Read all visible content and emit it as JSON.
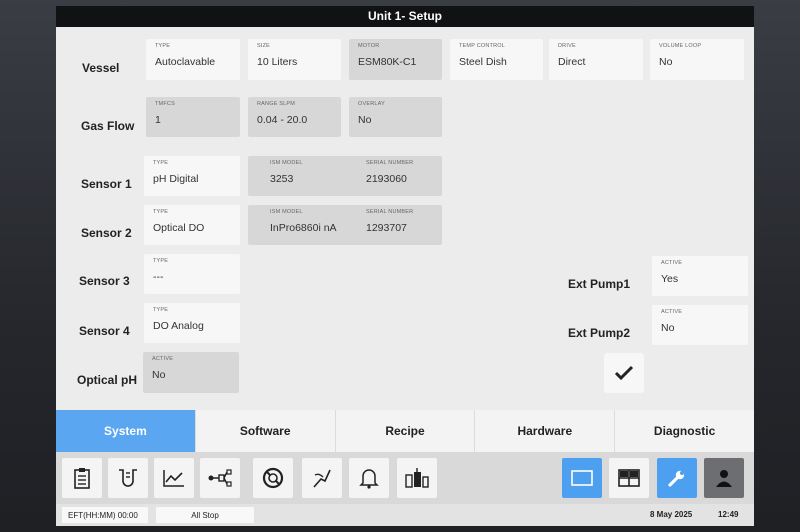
{
  "window": {
    "title": "Unit 1- Setup"
  },
  "rows": {
    "vessel": {
      "label": "Vessel",
      "fields": [
        {
          "label": "TYPE",
          "value": "Autoclavable"
        },
        {
          "label": "SIZE",
          "value": "10 Liters"
        },
        {
          "label": "MOTOR",
          "value": "ESM80K-C1"
        },
        {
          "label": "TEMP CONTROL",
          "value": "Steel Dish"
        },
        {
          "label": "DRIVE",
          "value": "Direct"
        },
        {
          "label": "VOLUME LOOP",
          "value": "No"
        }
      ]
    },
    "gasflow": {
      "label": "Gas Flow",
      "fields": [
        {
          "label": "TMFCS",
          "value": "1"
        },
        {
          "label": "RANGE   SLPM",
          "value": "0.04 - 20.0"
        },
        {
          "label": "OVERLAY",
          "value": "No"
        }
      ]
    },
    "sensor1": {
      "label": "Sensor 1",
      "fields": [
        {
          "label": "TYPE",
          "value": "pH Digital"
        },
        {
          "label": "ISM MODEL",
          "value": "3253"
        },
        {
          "label": "SERIAL NUMBER",
          "value": "2193060"
        }
      ]
    },
    "sensor2": {
      "label": "Sensor 2",
      "fields": [
        {
          "label": "TYPE",
          "value": "Optical DO"
        },
        {
          "label": "ISM MODEL",
          "value": "InPro6860i nA"
        },
        {
          "label": "SERIAL NUMBER",
          "value": "1293707"
        }
      ]
    },
    "sensor3": {
      "label": "Sensor 3",
      "fields": [
        {
          "label": "TYPE",
          "value": "---"
        }
      ]
    },
    "sensor4": {
      "label": "Sensor 4",
      "fields": [
        {
          "label": "TYPE",
          "value": "DO Analog"
        }
      ]
    },
    "opticalph": {
      "label": "Optical pH",
      "fields": [
        {
          "label": "ACTIVE",
          "value": "No"
        }
      ]
    }
  },
  "pumps": {
    "ext1": {
      "label": "Ext Pump1",
      "field_label": "ACTIVE",
      "value": "Yes"
    },
    "ext2": {
      "label": "Ext Pump2",
      "field_label": "ACTIVE",
      "value": "No"
    }
  },
  "tabs": [
    "System",
    "Software",
    "Recipe",
    "Hardware",
    "Diagnostic"
  ],
  "active_tab": "System",
  "status": {
    "eft": "EFT(HH:MM)  00:00",
    "allstop": "All Stop",
    "date": "8 May 2025",
    "time": "12:49"
  },
  "colors": {
    "accent": "#5aa6f0",
    "toolbar_blue": "#4d9ff0"
  }
}
